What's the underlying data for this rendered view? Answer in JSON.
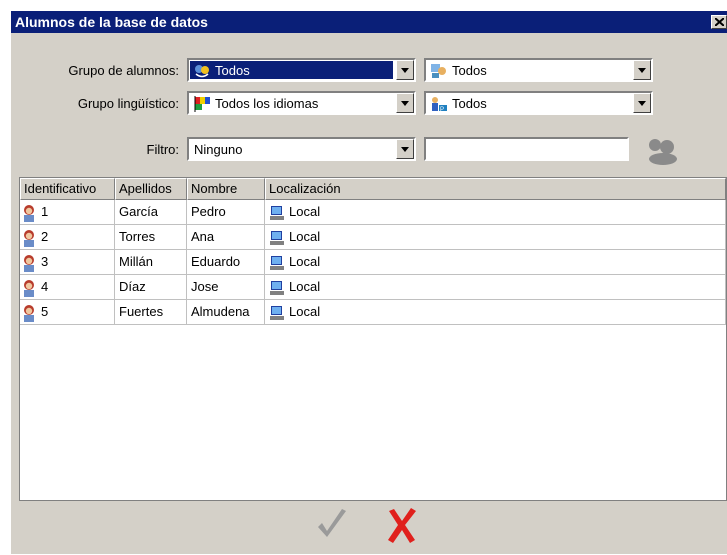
{
  "window": {
    "title": "Alumnos de la base de datos"
  },
  "filters": {
    "grupo_alumnos": {
      "label": "Grupo de alumnos:",
      "value1": "Todos",
      "value2": "Todos"
    },
    "grupo_linguistico": {
      "label": "Grupo lingüístico:",
      "value1": "Todos los idiomas",
      "value2": "Todos"
    },
    "filtro": {
      "label": "Filtro:",
      "value": "Ninguno",
      "text": ""
    }
  },
  "table": {
    "columns": [
      "Identificativo",
      "Apellidos",
      "Nombre",
      "Localización"
    ],
    "rows": [
      {
        "id": "1",
        "apellidos": "García",
        "nombre": "Pedro",
        "loc": "Local"
      },
      {
        "id": "2",
        "apellidos": "Torres",
        "nombre": "Ana",
        "loc": "Local"
      },
      {
        "id": "3",
        "apellidos": "Millán",
        "nombre": "Eduardo",
        "loc": "Local"
      },
      {
        "id": "4",
        "apellidos": "Díaz",
        "nombre": "Jose",
        "loc": "Local"
      },
      {
        "id": "5",
        "apellidos": "Fuertes",
        "nombre": "Almudena",
        "loc": "Local"
      }
    ]
  },
  "actions": {
    "accept_icon": "check-icon",
    "cancel_icon": "cross-icon"
  },
  "colors": {
    "titlebar": "#0a1f78",
    "face": "#d4d0c8",
    "cancel": "#e0201c",
    "accept": "#9a9a9a"
  }
}
